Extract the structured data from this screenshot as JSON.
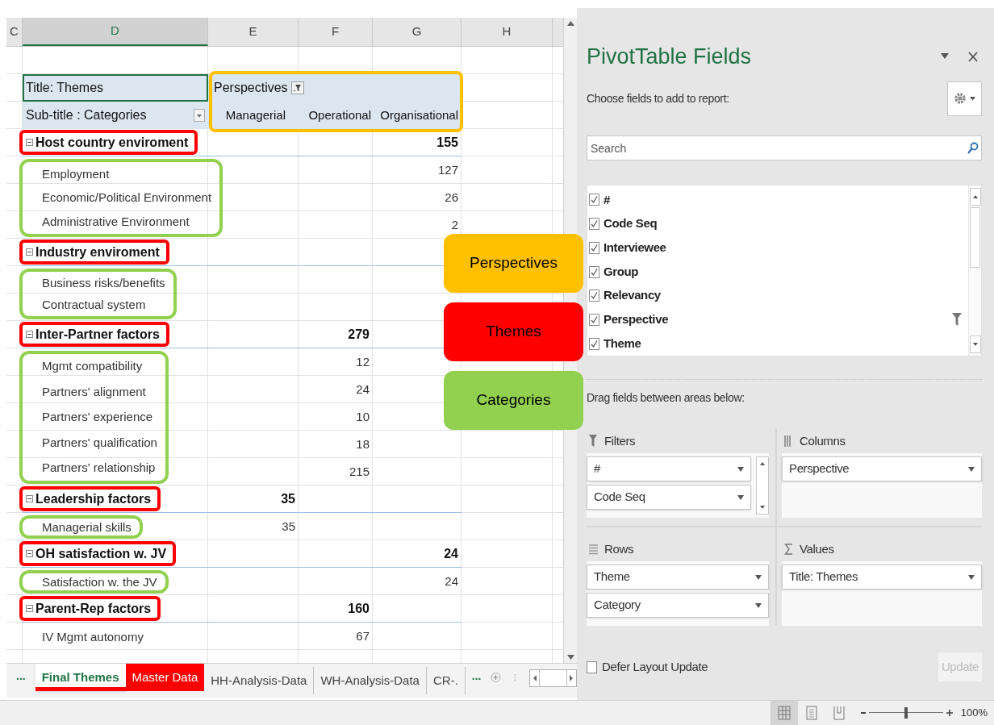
{
  "sheet": {
    "columns": [
      {
        "label": "C",
        "selected": false
      },
      {
        "label": "D",
        "selected": true
      },
      {
        "label": "E",
        "selected": false
      },
      {
        "label": "F",
        "selected": false
      },
      {
        "label": "G",
        "selected": false
      },
      {
        "label": "H",
        "selected": false
      }
    ],
    "pivot": {
      "title": "Title: Themes",
      "subtitle": "Sub-title : Categories",
      "column_field": "Perspectives",
      "column_labels": [
        "Managerial",
        "Operational",
        "Organisational"
      ],
      "themes": [
        {
          "name": "Host country enviroment",
          "expanded": true,
          "outlined": true,
          "values": {
            "column_g": "155"
          },
          "categories_outlined": true,
          "categories": [
            {
              "name": "Employment",
              "values": {
                "column_g": "127"
              }
            },
            {
              "name": "Economic/Political Environment",
              "values": {
                "column_g": "26"
              }
            },
            {
              "name": "Administrative Environment",
              "values": {
                "column_g": "2"
              }
            }
          ]
        },
        {
          "name": "Industry enviroment",
          "expanded": true,
          "outlined": true,
          "categories_outlined": true,
          "categories": [
            {
              "name": "Business risks/benefits"
            },
            {
              "name": "Contractual system"
            }
          ]
        },
        {
          "name": "Inter-Partner factors",
          "expanded": true,
          "outlined": true,
          "values": {
            "column_f": "279"
          },
          "categories_outlined": true,
          "categories": [
            {
              "name": "Mgmt compatibility",
              "values": {
                "column_f": "12"
              }
            },
            {
              "name": "Partners' alignment",
              "values": {
                "column_f": "24"
              }
            },
            {
              "name": "Partners' experience",
              "values": {
                "column_f": "10"
              }
            },
            {
              "name": "Partners' qualification",
              "values": {
                "column_f": "18"
              }
            },
            {
              "name": "Partners' relationship",
              "values": {
                "column_f": "215"
              }
            }
          ]
        },
        {
          "name": "Leadership factors",
          "expanded": true,
          "outlined": true,
          "values": {
            "column_e": "35"
          },
          "categories_outlined": true,
          "categories": [
            {
              "name": "Managerial skills",
              "values": {
                "column_e": "35"
              }
            }
          ]
        },
        {
          "name": "OH satisfaction w. JV",
          "expanded": true,
          "outlined": true,
          "values": {
            "column_g": "24"
          },
          "categories_outlined": true,
          "categories": [
            {
              "name": "Satisfaction w. the JV",
              "values": {
                "column_g": "24"
              }
            }
          ]
        },
        {
          "name": "Parent-Rep factors",
          "expanded": true,
          "outlined": true,
          "values": {
            "column_f": "160"
          },
          "categories_outlined": false,
          "categories": [
            {
              "name": "IV Mgmt autonomy",
              "values": {
                "column_f": "67"
              }
            }
          ]
        }
      ]
    },
    "more_left": "...",
    "tabs": [
      {
        "label": "Final Themes",
        "selected": true,
        "color": "#ff0000"
      },
      {
        "label": "Master Data",
        "selected": false,
        "color": "#ff0000"
      },
      {
        "label": "HH-Analysis-Data",
        "selected": false
      },
      {
        "label": "WH-Analysis-Data",
        "selected": false
      },
      {
        "label": "CR-.",
        "selected": false
      }
    ],
    "more_right": "..."
  },
  "callouts": [
    {
      "label": "Perspectives",
      "color": "#ffc000"
    },
    {
      "label": "Themes",
      "color": "#ff0000"
    },
    {
      "label": "Categories",
      "color": "#92d050"
    }
  ],
  "field_pane": {
    "title": "PivotTable Fields",
    "prompt": "Choose fields to add to report:",
    "search": {
      "placeholder": "Search"
    },
    "fields": [
      {
        "label": "#",
        "checked": true,
        "filtered": false
      },
      {
        "label": "Code Seq",
        "checked": true,
        "filtered": false
      },
      {
        "label": "Interviewee",
        "checked": true,
        "filtered": false
      },
      {
        "label": "Group",
        "checked": true,
        "filtered": false
      },
      {
        "label": "Relevancy",
        "checked": true,
        "filtered": false
      },
      {
        "label": "Perspective",
        "checked": true,
        "filtered": true
      },
      {
        "label": "Theme",
        "checked": true,
        "filtered": false
      }
    ],
    "drag_hint": "Drag fields between areas below:",
    "areas": [
      {
        "kind": "filters",
        "label": "Filters",
        "items": [
          "#",
          "Code Seq"
        ]
      },
      {
        "kind": "columns",
        "label": "Columns",
        "items": [
          "Perspective"
        ]
      },
      {
        "kind": "rows",
        "label": "Rows",
        "items": [
          "Theme",
          "Category"
        ]
      },
      {
        "kind": "values",
        "label": "Values",
        "items": [
          "Title: Themes"
        ]
      }
    ],
    "defer": {
      "label": "Defer Layout Update",
      "checked": false
    },
    "update_button": {
      "label": "Update",
      "disabled": true
    }
  },
  "status_bar": {
    "views": [
      {
        "kind": "normal",
        "selected": true
      },
      {
        "kind": "page_layout",
        "selected": false
      },
      {
        "kind": "page_break",
        "selected": false
      }
    ],
    "zoom": {
      "level": 0.5,
      "label": "100%"
    }
  }
}
